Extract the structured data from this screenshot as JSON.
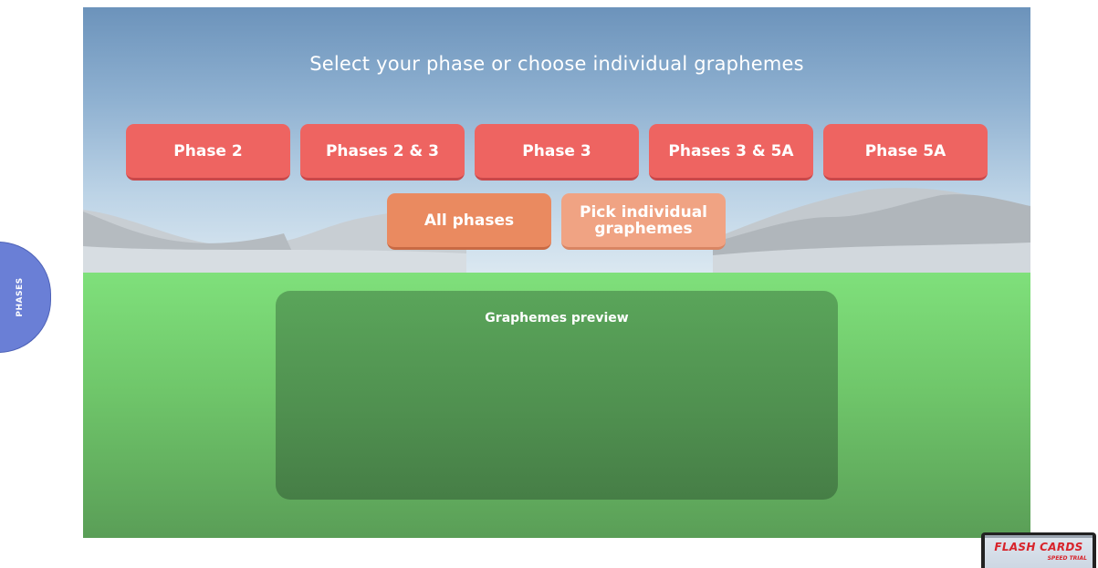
{
  "header": {
    "title": "Select your phase or choose individual graphemes"
  },
  "phase_buttons": [
    {
      "label": "Phase 2"
    },
    {
      "label": "Phases 2 & 3"
    },
    {
      "label": "Phase 3"
    },
    {
      "label": "Phases 3 & 5A"
    },
    {
      "label": "Phase 5A"
    }
  ],
  "secondary_buttons": {
    "all_phases": "All phases",
    "pick_individual_line1": "Pick individual",
    "pick_individual_line2": "graphemes"
  },
  "preview": {
    "title": "Graphemes preview"
  },
  "side_tab": {
    "label": "PHASES"
  },
  "thumbnail": {
    "title": "FLASH CARDS",
    "subtitle": "SPEED TRIAL"
  },
  "colors": {
    "phase_button": "#ee6461",
    "all_phases_button": "#ea8a60",
    "pick_button": "#f0a383",
    "side_tab": "#6a7fd6",
    "sky_top": "#6c93bb",
    "grass": "#7fe07b",
    "preview_panel": "#4f8f4f"
  }
}
